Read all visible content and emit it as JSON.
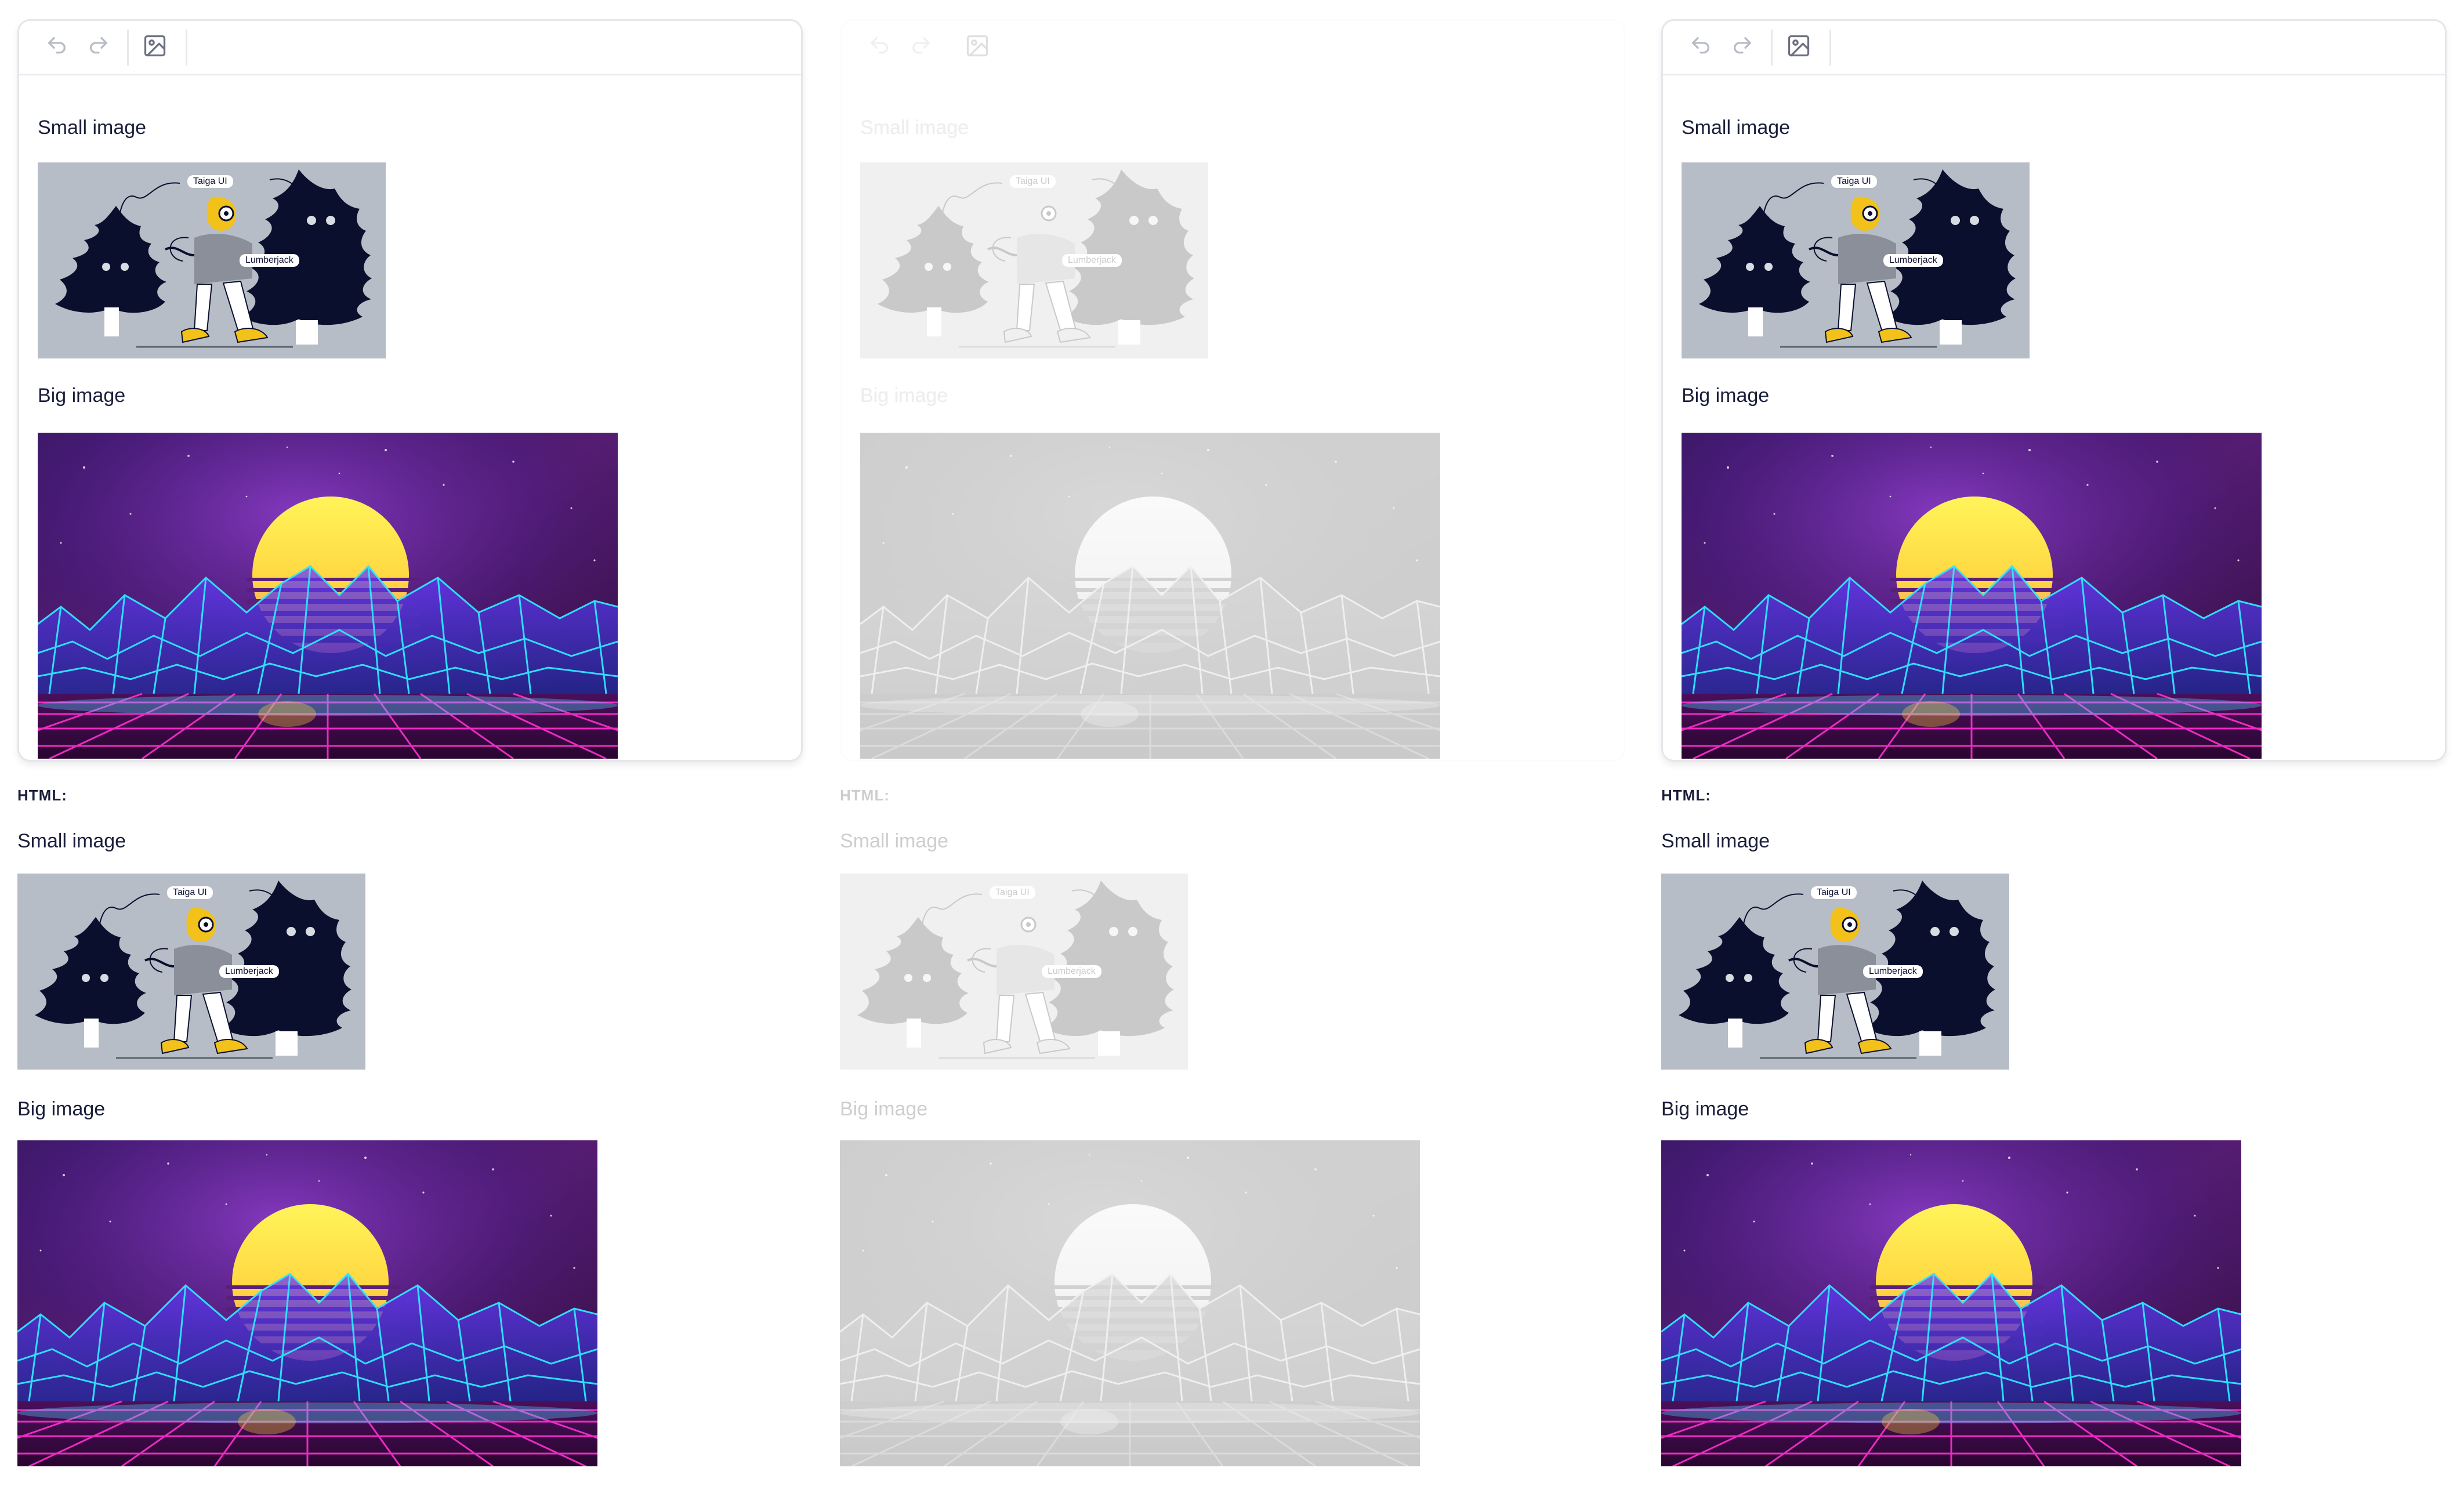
{
  "toolbar": {
    "undo_icon": "undo-icon",
    "redo_icon": "redo-icon",
    "image_icon": "image-icon"
  },
  "editor": {
    "small_label": "Small image",
    "big_label": "Big image"
  },
  "output": {
    "html_label": "HTML:",
    "small_label": "Small image",
    "big_label": "Big image"
  },
  "small_image": {
    "tag_1": "Taiga UI",
    "tag_2": "Lumberjack"
  },
  "colors": {
    "accent": "#1b1f3b",
    "small_bg": "#b7bdc6",
    "tree": "#0b0f2e",
    "yellow": "#f2c21a",
    "sun_top": "#fff45a",
    "sun_bottom": "#ff6fa8",
    "grid_cyan": "#30e6ff",
    "grid_magenta": "#ff2fd0"
  }
}
